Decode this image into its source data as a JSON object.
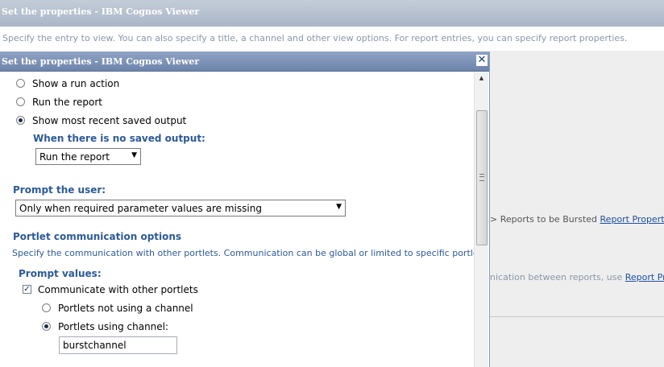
{
  "background": {
    "title": "Set the properties - IBM Cognos Viewer",
    "description": "Specify the entry to view. You can also specify a title, a channel and other view options. For report entries, you can specify report properties.",
    "burst_text": "> Reports to be Bursted",
    "burst_link": "Report Properties",
    "comm_text": "nication between reports, use",
    "comm_link": "Report Properties"
  },
  "dialog": {
    "title": "Set the properties - IBM Cognos Viewer",
    "close_glyph": "✕",
    "run_options": [
      {
        "label": "Show a run action",
        "selected": false
      },
      {
        "label": "Run the report",
        "selected": false
      },
      {
        "label": "Show most recent saved output",
        "selected": true
      }
    ],
    "no_saved_output_label": "When there is no saved output:",
    "no_saved_output_value": "Run the report",
    "prompt_user_label": "Prompt the user:",
    "prompt_user_value": "Only when required parameter values are missing",
    "portlet_comm_heading": "Portlet communication options",
    "portlet_comm_desc": "Specify the communication with other portlets. Communication can be global or limited to specific portlets using channels.",
    "prompt_values_label": "Prompt values:",
    "communicate_label": "Communicate with other portlets",
    "communicate_checked": true,
    "channel_options": [
      {
        "label": "Portlets not using a channel",
        "selected": false
      },
      {
        "label": "Portlets using channel:",
        "selected": true
      }
    ],
    "channel_value": "burstchannel"
  },
  "icons": {
    "dropdown": "chevron-down-icon",
    "close": "close-icon",
    "scroll_up": "scroll-up-arrow-icon"
  },
  "colors": {
    "heading": "#2c5a99",
    "dialog_title_bar": "#7a8fb5",
    "link": "#1c4fa0"
  }
}
